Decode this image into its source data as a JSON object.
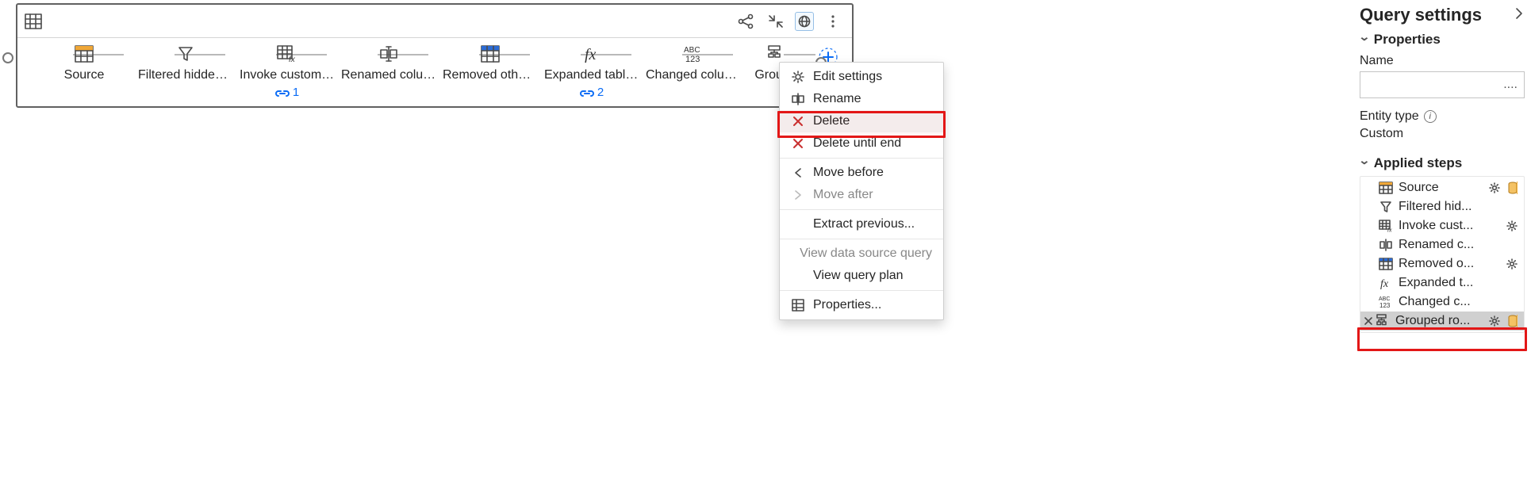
{
  "diagram": {
    "steps": [
      {
        "label": "Source"
      },
      {
        "label": "Filtered hidden fi..."
      },
      {
        "label": "Invoke custom fu...",
        "badge": "1"
      },
      {
        "label": "Renamed columns"
      },
      {
        "label": "Removed other c..."
      },
      {
        "label": "Expanded table c...",
        "badge": "2"
      },
      {
        "label": "Changed column..."
      },
      {
        "label": "Groupe"
      }
    ]
  },
  "context_menu": {
    "items": {
      "edit_settings": "Edit settings",
      "rename": "Rename",
      "delete": "Delete",
      "delete_until_end": "Delete until end",
      "move_before": "Move before",
      "move_after": "Move after",
      "extract_previous": "Extract previous...",
      "view_data_source_query": "View data source query",
      "view_query_plan": "View query plan",
      "properties": "Properties..."
    }
  },
  "settings": {
    "title": "Query settings",
    "properties_header": "Properties",
    "name_label": "Name",
    "name_value": "....",
    "entity_type_label": "Entity type",
    "entity_type_value": "Custom",
    "applied_steps_header": "Applied steps",
    "steps": [
      {
        "label": "Source",
        "gear": true,
        "db": true
      },
      {
        "label": "Filtered hid..."
      },
      {
        "label": "Invoke cust...",
        "gear": true
      },
      {
        "label": "Renamed c..."
      },
      {
        "label": "Removed o...",
        "gear": true
      },
      {
        "label": "Expanded t..."
      },
      {
        "label": "Changed c..."
      },
      {
        "label": "Grouped ro...",
        "gear": true,
        "db": true,
        "selected": true,
        "x": true
      }
    ]
  }
}
